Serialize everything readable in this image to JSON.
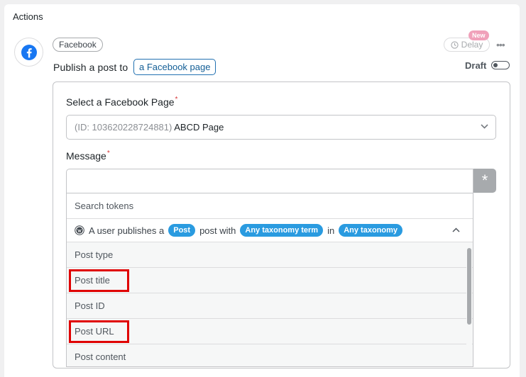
{
  "section": {
    "heading": "Actions"
  },
  "action": {
    "integration_pill": "Facebook",
    "sentence_prefix": "Publish a post to",
    "token_button": "a Facebook page",
    "delay_label": "Delay",
    "new_badge": "New",
    "more_glyph": "•••",
    "draft_label": "Draft"
  },
  "form": {
    "page_field": {
      "label": "Select a Facebook Page",
      "required_mark": "*",
      "value_id": "(ID: 103620228724881)",
      "value_name": "ABCD Page"
    },
    "message_field": {
      "label": "Message",
      "required_mark": "*",
      "token_button_glyph": "*"
    }
  },
  "token_dropdown": {
    "search_placeholder": "Search tokens",
    "trigger": {
      "text_1": "A user publishes a",
      "badge_1": "Post",
      "text_2": "post with",
      "badge_2": "Any taxonomy term",
      "text_3": "in",
      "badge_3": "Any taxonomy"
    },
    "items": [
      {
        "label": "Post type",
        "highlighted": false
      },
      {
        "label": "Post title",
        "highlighted": true
      },
      {
        "label": "Post ID",
        "highlighted": false
      },
      {
        "label": "Post URL",
        "highlighted": true
      },
      {
        "label": "Post content",
        "highlighted": false
      }
    ]
  },
  "colors": {
    "accent": "#2271b1",
    "badge": "#2a9be0",
    "highlight": "#e00000",
    "new_badge": "#f0a1ba"
  }
}
